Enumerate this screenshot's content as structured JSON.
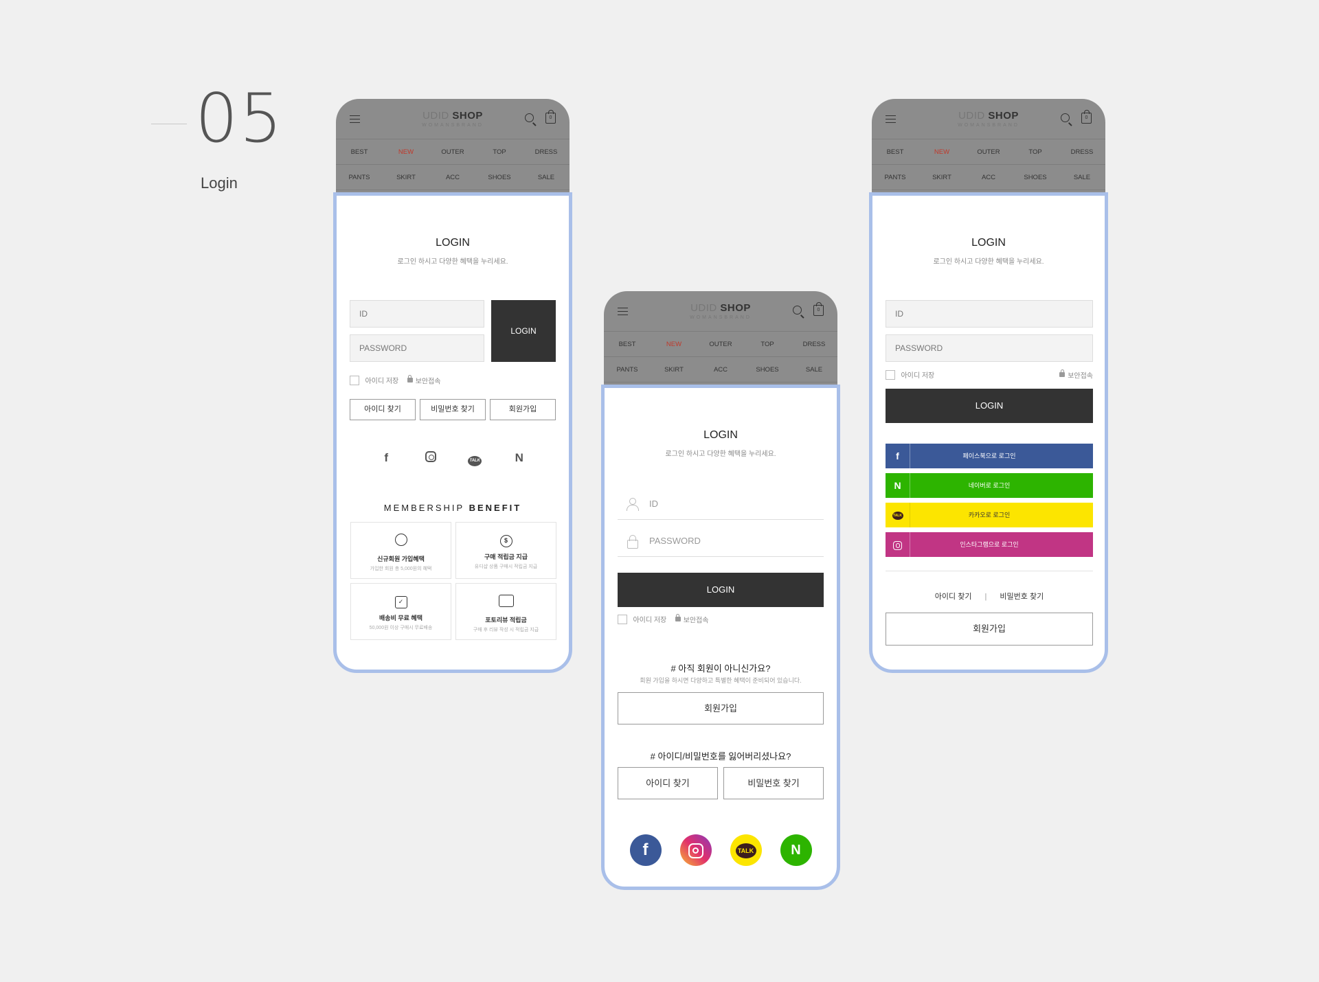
{
  "section": {
    "number": "05",
    "title": "Login"
  },
  "header": {
    "logo_light": "UDID",
    "logo_bold": "SHOP",
    "logo_sub": "WOMANSBRAND",
    "cart_count": "0",
    "nav": [
      "BEST",
      "NEW",
      "OUTER",
      "TOP",
      "DRESS",
      "PANTS",
      "SKIRT",
      "ACC",
      "SHOES",
      "SALE"
    ]
  },
  "login": {
    "title": "LOGIN",
    "subtitle": "로그인 하시고 다양한 혜택을 누리세요.",
    "id_placeholder": "ID",
    "pw_placeholder": "PASSWORD",
    "login_button": "LOGIN",
    "save_id": "아이디 저장",
    "secure": "보안접속",
    "find_id": "아이디 찾기",
    "find_pw": "비밀번호 찾기",
    "join": "회원가입",
    "divider": "|"
  },
  "phone1": {
    "sns_icons": [
      "facebook-icon",
      "instagram-icon",
      "kakaotalk-icon",
      "naver-icon"
    ],
    "sns_f": "f",
    "sns_talk": "TALK",
    "sns_n": "N",
    "membership_prefix": "MEMBERSHIP",
    "membership_bold": "BENEFIT",
    "benefits": [
      {
        "icon": "user-icon",
        "glyph": "",
        "title": "신규회원 가입혜택",
        "desc": "가입한 회원 총 5,000원의 혜택"
      },
      {
        "icon": "coin-icon",
        "glyph": "$",
        "title": "구매 적립금 지급",
        "desc": "유디샵 상품 구매시 적립금 지급"
      },
      {
        "icon": "delivery-box-icon",
        "glyph": "✓",
        "title": "배송비 무료 혜택",
        "desc": "50,000원 이상 구매시 무료배송"
      },
      {
        "icon": "camera-icon",
        "glyph": "",
        "title": "포토리뷰 적립금",
        "desc": "구매 후 리뷰 작성 시 적립금 지급"
      }
    ]
  },
  "phone2": {
    "not_member_q": "# 아직 회원이 아니신가요?",
    "not_member_desc": "회원 가입을 하시면 다양하고 특별한 혜택이 준비되어 있습니다.",
    "lost_q": "# 아이디/비밀번호를 잃어버리셨나요?",
    "sns_f": "f",
    "sns_talk": "TALK",
    "sns_n": "N"
  },
  "phone3": {
    "sns_buttons": [
      {
        "label": "페이스북으로 로그인",
        "icon": "f"
      },
      {
        "label": "네이버로 로그인",
        "icon": "N"
      },
      {
        "label": "카카오로 로그인",
        "icon": "TALK"
      },
      {
        "label": "인스타그램으로 로그인",
        "icon": ""
      }
    ]
  },
  "colors": {
    "accent_border": "#a9bfe9",
    "header_gray": "#8c8c8c",
    "button_dark": "#333333",
    "new_red": "#c0392b",
    "facebook": "#3b5998",
    "naver": "#2db400",
    "kakao": "#fce500",
    "instagram": "#c13584"
  }
}
